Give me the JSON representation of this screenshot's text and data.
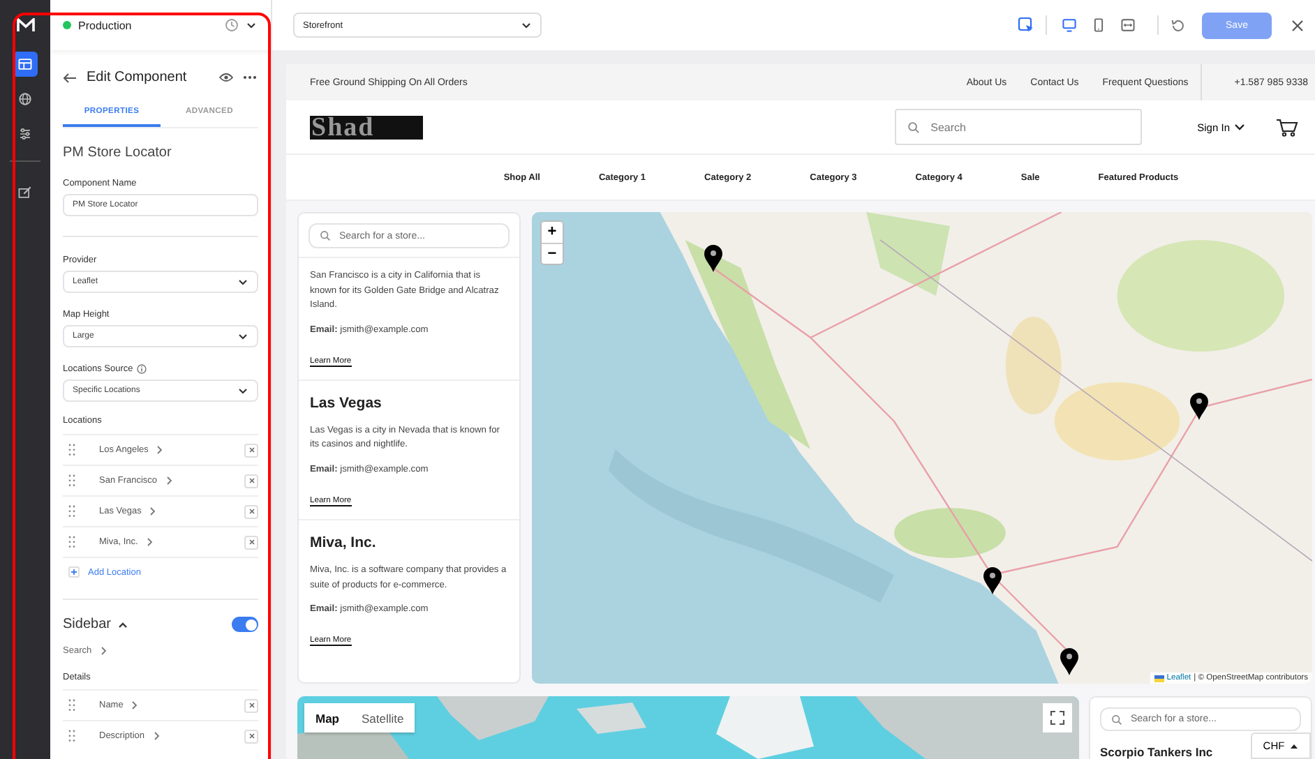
{
  "rail": [
    {
      "kind": "layout",
      "selected": true
    },
    {
      "kind": "globe",
      "selected": false
    },
    {
      "kind": "sliders",
      "selected": false
    },
    {
      "kind": "edit",
      "selected": false
    }
  ],
  "environment": {
    "name": "Production"
  },
  "editor": {
    "title": "Edit Component",
    "tabs": [
      {
        "label": "PROPERTIES",
        "selected": true
      },
      {
        "label": "ADVANCED",
        "selected": false
      }
    ],
    "component_title": "PM Store Locator",
    "name_field": {
      "label": "Component Name",
      "value": "PM Store Locator"
    },
    "fields": [
      {
        "label": "Provider",
        "value": "Leaflet"
      },
      {
        "label": "Map Height",
        "value": "Large"
      },
      {
        "label": "Locations Source",
        "value": "Specific Locations",
        "info": true
      }
    ],
    "locations": {
      "label": "Locations",
      "items": [
        "Los Angeles",
        "San Francisco",
        "Las Vegas",
        "Miva, Inc."
      ],
      "add_label": "Add Location"
    },
    "sidebar_section": {
      "title": "Sidebar",
      "expanded": true,
      "on": true,
      "search_label": "Search",
      "details_label": "Details",
      "details": [
        "Name",
        "Description"
      ]
    }
  },
  "toolbar": {
    "page_select": "Storefront",
    "devices": [
      {
        "kind": "desktop",
        "selected": true
      },
      {
        "kind": "tablet",
        "selected": false
      },
      {
        "kind": "responsive",
        "selected": false
      }
    ],
    "save": {
      "label": "Save",
      "disabled": true
    }
  },
  "storefront": {
    "announcement": "Free Ground Shipping On All Orders",
    "top_links": [
      "About Us",
      "Contact Us",
      "Frequent Questions"
    ],
    "phone": "+1.587 985 9338",
    "logo": "Shad",
    "search_placeholder": "Search",
    "sign_in": "Sign In",
    "nav": [
      "Shop All",
      "Category 1",
      "Category 2",
      "Category 3",
      "Category 4",
      "Sale",
      "Featured Products"
    ],
    "store_list": {
      "search_placeholder": "Search for a store...",
      "stores": [
        {
          "description": "San Francisco is a city in California that is known for its Golden Gate Bridge and Alcatraz Island.",
          "email": "**Email:** jsmith@example.com",
          "link": "Learn More"
        },
        {
          "name": "Las Vegas",
          "description": "Las Vegas is a city in Nevada that is known for its casinos and nightlife.",
          "email": "**Email:** jsmith@example.com",
          "link": "Learn More"
        },
        {
          "name": "Miva, Inc.",
          "description": "Miva, Inc. is a software company that provides a suite of products for e-commerce.",
          "email": "**Email:** jsmith@example.com",
          "link": "Learn More"
        }
      ]
    },
    "map": {
      "zoom_in": "+",
      "zoom_out": "−",
      "attribution_link": "Leaflet",
      "attribution": "| © OpenStreetMap contributors"
    },
    "map2": {
      "tabs": [
        {
          "label": "Map",
          "selected": true
        },
        {
          "label": "Satellite",
          "selected": false
        }
      ]
    },
    "store_list_2": {
      "search_placeholder": "Search for a store...",
      "first_store": "Scorpio Tankers Inc"
    },
    "currency": {
      "label": "CHF"
    }
  }
}
